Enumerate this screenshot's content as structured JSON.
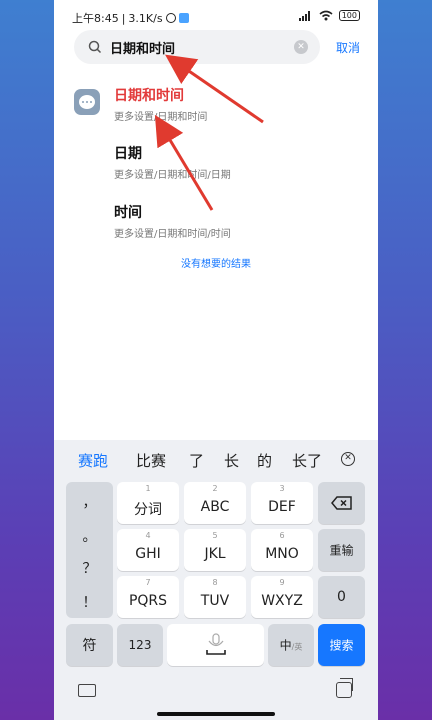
{
  "status_bar": {
    "time": "上午8:45",
    "speed": "3.1K/s",
    "battery": "100"
  },
  "search": {
    "value": "日期和时间",
    "cancel_label": "取消"
  },
  "results": [
    {
      "title": "日期和时间",
      "path": "更多设置/日期和时间"
    },
    {
      "title": "日期",
      "path": "更多设置/日期和时间/日期"
    },
    {
      "title": "时间",
      "path": "更多设置/日期和时间/时间"
    }
  ],
  "no_result_label": "没有想要的结果",
  "keyboard": {
    "candidates": [
      "赛跑",
      "比赛",
      "了",
      "长",
      "的",
      "长了"
    ],
    "punctuation": [
      "，",
      "。",
      "？",
      "！"
    ],
    "keys": [
      {
        "num": "1",
        "label": "分词"
      },
      {
        "num": "2",
        "label": "ABC"
      },
      {
        "num": "3",
        "label": "DEF"
      },
      {
        "num": "4",
        "label": "GHI"
      },
      {
        "num": "5",
        "label": "JKL"
      },
      {
        "num": "6",
        "label": "MNO"
      },
      {
        "num": "7",
        "label": "PQRS"
      },
      {
        "num": "8",
        "label": "TUV"
      },
      {
        "num": "9",
        "label": "WXYZ"
      }
    ],
    "reenter_label": "重输",
    "zero_label": "0",
    "symbol_label": "符",
    "num_label": "123",
    "lang_label": "中",
    "lang_sub": "/英",
    "search_label": "搜索"
  },
  "colors": {
    "accent": "#1677ff",
    "highlight_title": "#e23a3a",
    "annotation_arrow": "#e03a2f"
  }
}
